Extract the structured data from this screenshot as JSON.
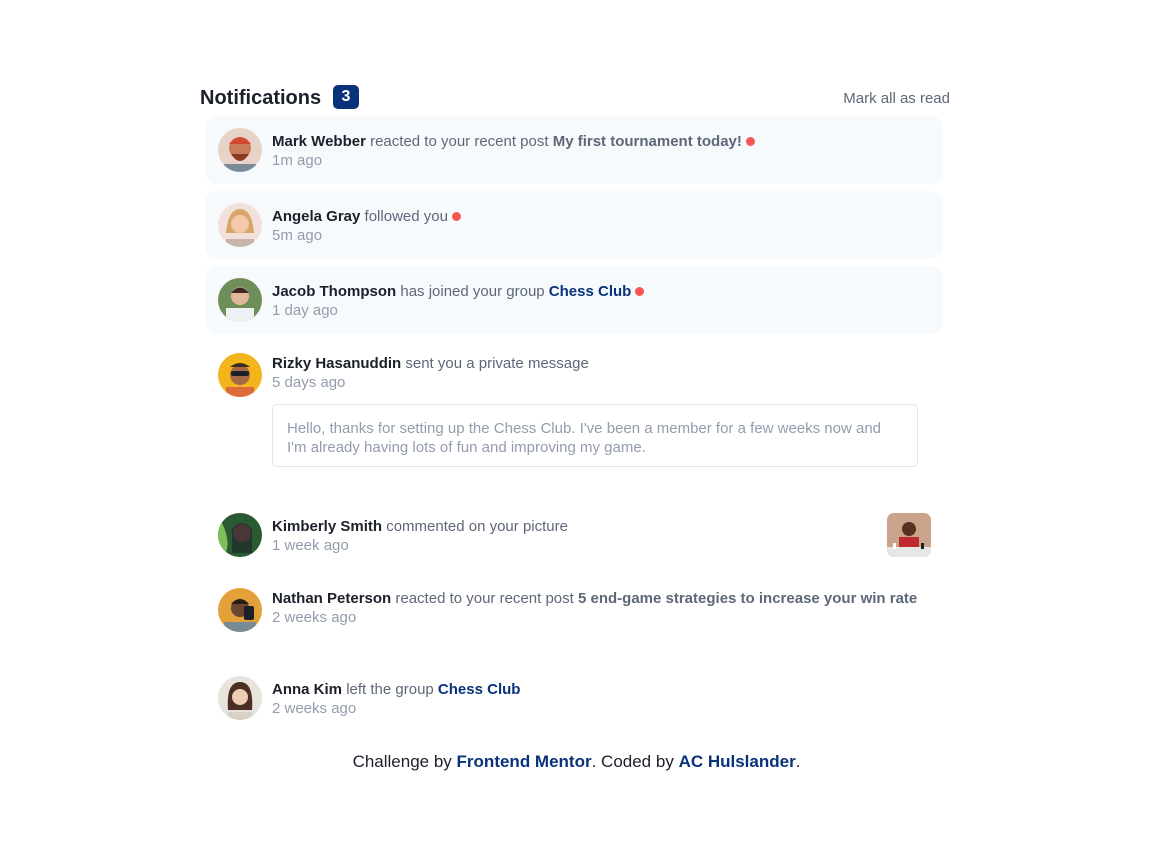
{
  "header": {
    "title": "Notifications",
    "count": "3",
    "mark_all": "Mark all as read"
  },
  "notifications": [
    {
      "name": "Mark Webber",
      "action": "reacted to your recent post",
      "target": "My first tournament today!",
      "time": "1m ago"
    },
    {
      "name": "Angela Gray",
      "action": "followed you",
      "time": "5m ago"
    },
    {
      "name": "Jacob Thompson",
      "action": "has joined your group",
      "target": "Chess Club",
      "time": "1 day ago"
    },
    {
      "name": "Rizky Hasanuddin",
      "action": "sent you a private message",
      "time": "5 days ago",
      "message": "Hello, thanks for setting up the Chess Club. I've been a member for a few weeks now and I'm already having lots of fun and improving my game."
    },
    {
      "name": "Kimberly Smith",
      "action": "commented on your picture",
      "time": "1 week ago"
    },
    {
      "name": "Nathan Peterson",
      "action": "reacted to your recent post",
      "target": "5 end-game strategies to increase your win rate",
      "time": "2 weeks ago"
    },
    {
      "name": "Anna Kim",
      "action": "left the group",
      "target": "Chess Club",
      "time": "2 weeks ago"
    }
  ],
  "footer": {
    "prefix": "Challenge by",
    "link1": "Frontend Mentor",
    "middle": ". Coded by",
    "link2": "AC Hulslander",
    "suffix": "."
  },
  "colors": {
    "accent": "#0a327b",
    "dot": "#f65552",
    "unread_bg": "#f7fafd"
  }
}
